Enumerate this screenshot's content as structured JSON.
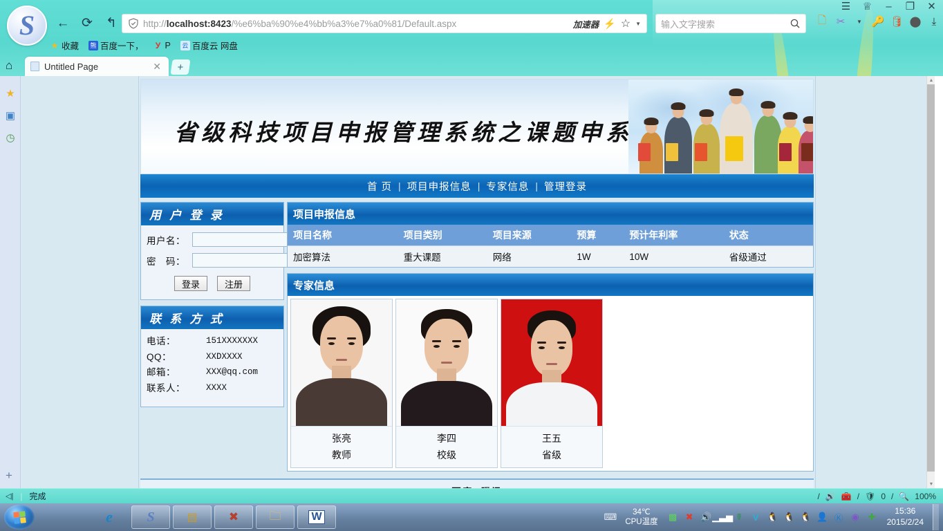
{
  "browser": {
    "logo_glyph": "S",
    "nav": {
      "back": "←",
      "reload": "⟳",
      "forward_history": "↰",
      "caret": "▾"
    },
    "url": {
      "prefix": "http://",
      "host": "localhost:8423",
      "path": "/%e6%ba%90%e4%bb%a3%e7%a0%81/Default.aspx",
      "full": "http://localhost:8423/%e6%ba%90%e4%bb%a3%e7%a0%81/Default.aspx"
    },
    "accelerator_label": "加速器",
    "search": {
      "placeholder": "输入文字搜索",
      "value": ""
    },
    "window_controls": {
      "menu": "☰",
      "skin": "♕",
      "minimize": "–",
      "maximize": "❐",
      "close": "✕"
    },
    "bookmarks": [
      {
        "label": "收藏",
        "icon": "star-icon"
      },
      {
        "label": "百度一下，",
        "icon": "baidu-icon"
      },
      {
        "label": "P",
        "icon": "yandex-icon"
      },
      {
        "label": "百度云 网盘",
        "icon": "baidu-pan-icon"
      }
    ],
    "tab": {
      "title": "Untitled Page",
      "close": "✕"
    },
    "newtab_label": "+",
    "sidebar_rail": [
      {
        "name": "favorites-rail-icon",
        "glyph": "★",
        "color": "#f0b429"
      },
      {
        "name": "reading-rail-icon",
        "glyph": "▣",
        "color": "#3f83c9"
      },
      {
        "name": "history-rail-icon",
        "glyph": "◷",
        "color": "#4b9b4b"
      }
    ],
    "rail_add": "+"
  },
  "site": {
    "banner_title": "省级科技项目申报管理系统之课题申系统",
    "nav_links": [
      "首 页",
      "项目申报信息",
      "专家信息",
      "管理登录"
    ],
    "nav_separator": "|",
    "login_panel": {
      "title": "用 户 登 录",
      "fields": [
        {
          "label": "用户名：",
          "value": "",
          "name": "username-field"
        },
        {
          "label": "密　码：",
          "value": "",
          "name": "password-field"
        }
      ],
      "buttons": [
        {
          "label": "登录",
          "name": "login-button"
        },
        {
          "label": "注册",
          "name": "register-button"
        }
      ]
    },
    "contact_panel": {
      "title": "联 系 方 式",
      "rows": [
        {
          "key": "电话：",
          "value": "151XXXXXXX"
        },
        {
          "key": "QQ：",
          "value": "XXDXXXX"
        },
        {
          "key": "邮箱：",
          "value": "XXX@qq.com"
        },
        {
          "key": "联系人：",
          "value": "XXXX"
        }
      ]
    },
    "project_section": {
      "title": "项目申报信息",
      "columns": [
        "项目名称",
        "项目类别",
        "项目来源",
        "预算",
        "预计年利率",
        "状态"
      ],
      "rows": [
        [
          "加密算法",
          "重大课题",
          "网络",
          "1W",
          "10W",
          "省级通过"
        ]
      ]
    },
    "expert_section": {
      "title": "专家信息",
      "experts": [
        {
          "name": "张亮",
          "rank": "教师",
          "bg": "#f7f7f7",
          "hair": "#17120f",
          "shirt": "#4a3a36"
        },
        {
          "name": "李四",
          "rank": "校级",
          "bg": "#fafafa",
          "hair": "#1b1310",
          "shirt": "#221a1c"
        },
        {
          "name": "王五",
          "rank": "省级",
          "bg": "#cf1010",
          "hair": "#1a120e",
          "shirt": "#f3f4f6"
        }
      ]
    },
    "footer_links": [
      "百度",
      "腾讯"
    ]
  },
  "statusbar": {
    "collapse": "◁|",
    "text": "完成",
    "ad_count": "0",
    "zoom": "100%"
  },
  "taskbar": {
    "items": [
      {
        "name": "taskbar-ie",
        "glyph": "e",
        "color": "#1b84c8"
      },
      {
        "name": "taskbar-sogou-browser",
        "glyph": "S",
        "color": "#5b7fc4"
      },
      {
        "name": "taskbar-sql-tool",
        "glyph": "▤",
        "color": "#c89b2a"
      },
      {
        "name": "taskbar-visual-studio",
        "glyph": "∞",
        "color": "#b5402f"
      },
      {
        "name": "taskbar-explorer",
        "glyph": "🗀",
        "color": "#e3c26a"
      },
      {
        "name": "taskbar-word",
        "glyph": "W",
        "color": "#2a5699"
      }
    ],
    "cpu_temp_value": "34℃",
    "cpu_temp_label": "CPU温度",
    "time": "15:36",
    "date": "2015/2/24"
  },
  "colors": {
    "chrome": "#5bd9d0",
    "site_blue": "#0d63b2",
    "table_header": "#6f9fd8",
    "accent": "#1e86d0"
  }
}
